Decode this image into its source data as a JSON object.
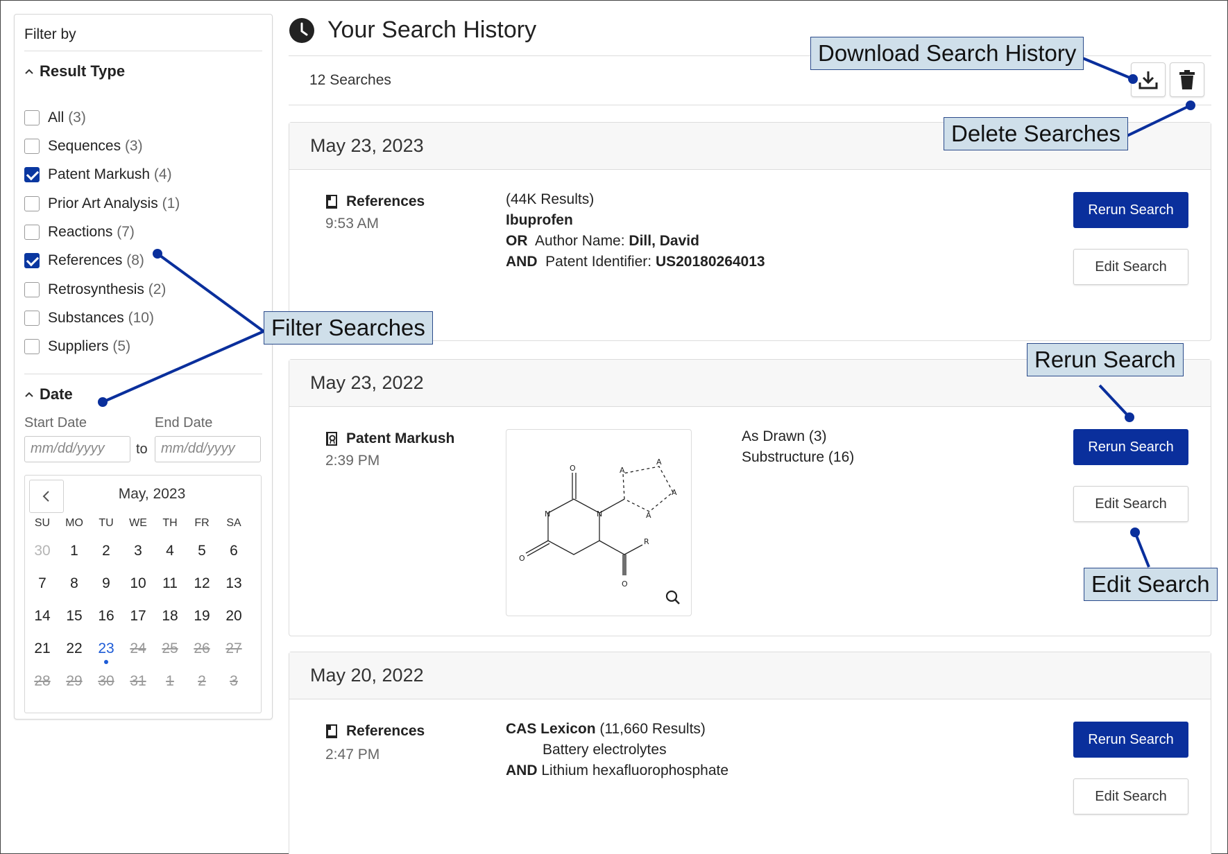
{
  "sidebar": {
    "title": "Filter by",
    "result_type": {
      "heading": "Result Type",
      "items": [
        {
          "label": "All",
          "count": "(3)",
          "checked": false
        },
        {
          "label": "Sequences",
          "count": "(3)",
          "checked": false
        },
        {
          "label": "Patent Markush",
          "count": "(4)",
          "checked": true
        },
        {
          "label": "Prior Art Analysis",
          "count": "(1)",
          "checked": false
        },
        {
          "label": "Reactions",
          "count": "(7)",
          "checked": false
        },
        {
          "label": "References",
          "count": "(8)",
          "checked": true
        },
        {
          "label": "Retrosynthesis",
          "count": "(2)",
          "checked": false
        },
        {
          "label": "Substances",
          "count": "(10)",
          "checked": false
        },
        {
          "label": "Suppliers",
          "count": "(5)",
          "checked": false
        }
      ]
    },
    "date": {
      "heading": "Date",
      "start_label": "Start Date",
      "end_label": "End Date",
      "start_placeholder": "mm/dd/yyyy",
      "end_placeholder": "mm/dd/yyyy",
      "to_label": "to"
    },
    "calendar": {
      "month_label": "May, 2023",
      "weekdays": [
        "SU",
        "MO",
        "TU",
        "WE",
        "TH",
        "FR",
        "SA"
      ],
      "weeks": [
        [
          "30",
          "1",
          "2",
          "3",
          "4",
          "5",
          "6"
        ],
        [
          "7",
          "8",
          "9",
          "10",
          "11",
          "12",
          "13"
        ],
        [
          "14",
          "15",
          "16",
          "17",
          "18",
          "19",
          "20"
        ],
        [
          "21",
          "22",
          "23",
          "24",
          "25",
          "26",
          "27"
        ],
        [
          "28",
          "29",
          "30",
          "31",
          "1",
          "2",
          "3"
        ]
      ],
      "today": "23"
    }
  },
  "header": {
    "title": "Your Search History",
    "count": "12 Searches"
  },
  "cards": [
    {
      "date": "May 23, 2023",
      "type": "References",
      "time": "9:53 AM",
      "results": "(44K Results)",
      "term": "Ibuprofen",
      "line2_op": "OR",
      "line2_field": "Author Name:",
      "line2_value": "Dill, David",
      "line3_op": "AND",
      "line3_field": "Patent Identifier:",
      "line3_value": "US20180264013",
      "rerun": "Rerun Search",
      "edit": "Edit Search"
    },
    {
      "date": "May 23, 2022",
      "type": "Patent Markush",
      "time": "2:39 PM",
      "opt1": "As Drawn (3)",
      "opt2": "Substructure (16)",
      "rerun": "Rerun Search",
      "edit": "Edit Search"
    },
    {
      "date": "May 20, 2022",
      "type": "References",
      "time": "2:47 PM",
      "source": "CAS Lexicon",
      "results": "(11,660 Results)",
      "term1": "Battery electrolytes",
      "op": "AND",
      "term2": "Lithium hexafluorophosphate",
      "rerun": "Rerun Search",
      "edit": "Edit Search"
    }
  ],
  "callouts": {
    "download": "Download Search History",
    "delete": "Delete Searches",
    "filter": "Filter Searches",
    "rerun": "Rerun Search",
    "edit": "Edit Search"
  },
  "colors": {
    "primary": "#0a2f9c",
    "callout_bg": "#cfdfea",
    "callout_line": "#0a2f9c",
    "today": "#1d5bd6"
  }
}
